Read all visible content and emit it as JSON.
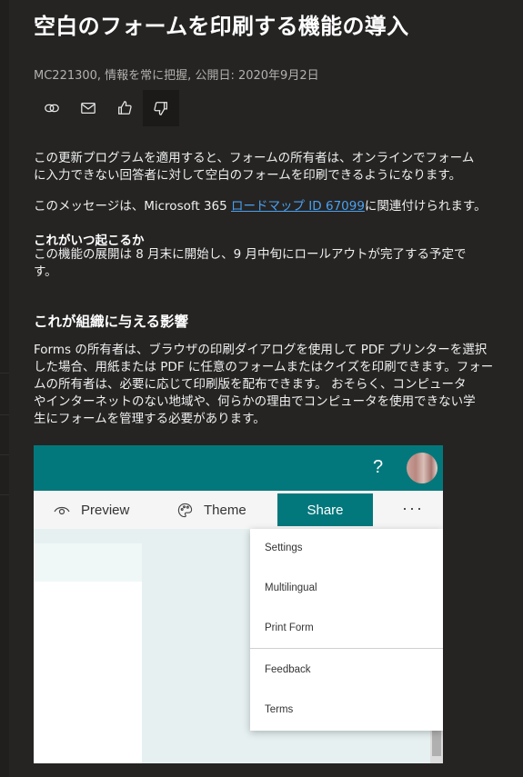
{
  "article": {
    "title": "空白のフォームを印刷する機能の導入",
    "meta": "MC221300, 情報を常に把握, 公開日: 2020年9月2日",
    "actions": [
      {
        "icon": "link-icon"
      },
      {
        "icon": "mail-icon"
      },
      {
        "icon": "thumbs-up-icon"
      },
      {
        "icon": "thumbs-down-icon"
      }
    ],
    "para1_line1": "この更新プログラムを適用すると、フォームの所有者は、オンラインでフォーム",
    "para1_line2": "に入力できない回答者に対して空白のフォームを印刷できるようになります。",
    "para2_before": "このメッセージは、Microsoft 365 ",
    "para2_link": "ロードマップ ID 67099",
    "para2_after": "に関連付けられます。",
    "when_heading": "これがいつ起こるか",
    "when_line1": "この機能の展開は 8 月末に開始し、9 月中旬にロールアウトが完了する予定で",
    "when_line2": "す。",
    "impact_heading": "これが組織に与える影響",
    "impact_line1": "Forms の所有者は、ブラウザの印刷ダイアログを使用して PDF プリンターを選択",
    "impact_line2": "した場合、用紙または PDF に任意のフォームまたはクイズを印刷できます。フォー",
    "impact_line3": "ムの所有者は、必要に応じて印刷版を配布できます。 おそらく、コンピュータ",
    "impact_line4": "やインターネットのない地域や、何らかの理由でコンピュータを使用できない学",
    "impact_line5": "生にフォームを管理する必要があります。"
  },
  "screenshot": {
    "help": "?",
    "preview_label": "Preview",
    "theme_label": "Theme",
    "share_label": "Share",
    "more": "···",
    "menu": [
      "Settings",
      "Multilingual",
      "Print Form",
      "Feedback",
      "Terms"
    ],
    "colors": {
      "brand": "#03787c",
      "link": "#4aa0f0",
      "page_bg": "#252423"
    }
  }
}
